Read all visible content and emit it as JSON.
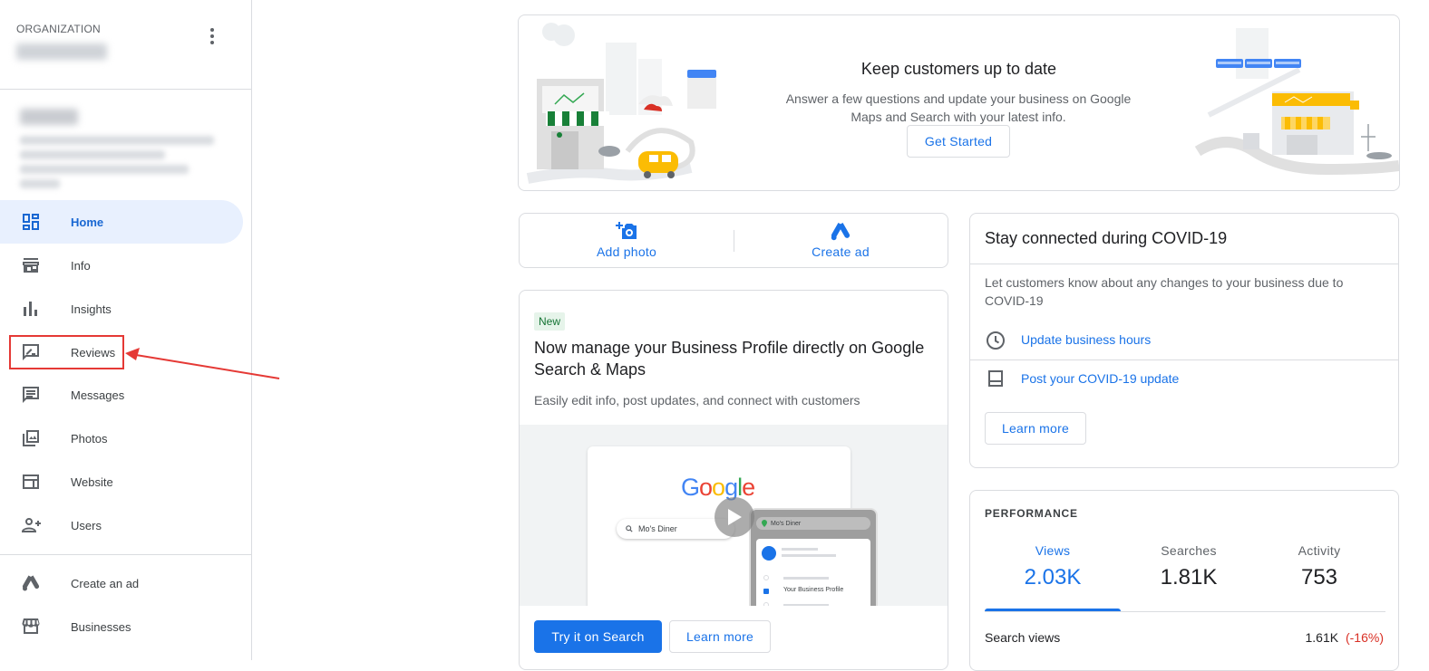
{
  "sidebar": {
    "org_label": "ORGANIZATION",
    "nav": [
      {
        "label": "Home",
        "icon": "dashboard-icon"
      },
      {
        "label": "Info",
        "icon": "storefront-icon"
      },
      {
        "label": "Insights",
        "icon": "bar-chart-icon"
      },
      {
        "label": "Reviews",
        "icon": "rate-review-icon"
      },
      {
        "label": "Messages",
        "icon": "chat-icon"
      },
      {
        "label": "Photos",
        "icon": "photo-library-icon"
      },
      {
        "label": "Website",
        "icon": "web-icon"
      },
      {
        "label": "Users",
        "icon": "person-add-icon"
      }
    ],
    "nav_bottom": [
      {
        "label": "Create an ad",
        "icon": "google-ads-icon"
      },
      {
        "label": "Businesses",
        "icon": "store-icon"
      }
    ]
  },
  "hero": {
    "title": "Keep customers up to date",
    "subtitle": "Answer a few questions and update your business on Google Maps and Search with your latest info.",
    "button": "Get Started"
  },
  "quick_actions": {
    "add_photo": "Add photo",
    "create_ad": "Create ad"
  },
  "new_profile": {
    "badge": "New",
    "title": "Now manage your Business Profile directly on Google Search & Maps",
    "subtitle": "Easily edit info, post updates, and connect with customers",
    "preview": {
      "logo": "Google",
      "search_text": "Mo's Diner",
      "map_pill": "Mo's Diner",
      "list_item": "Your Business Profile"
    },
    "primary_button": "Try it on Search",
    "secondary_button": "Learn more"
  },
  "covid": {
    "title": "Stay connected during COVID-19",
    "text": "Let customers know about any changes to your business due to COVID-19",
    "link_hours": "Update business hours",
    "link_post": "Post your COVID-19 update",
    "button": "Learn more"
  },
  "performance": {
    "label": "PERFORMANCE",
    "tabs": [
      {
        "label": "Views",
        "value": "2.03K"
      },
      {
        "label": "Searches",
        "value": "1.81K"
      },
      {
        "label": "Activity",
        "value": "753"
      }
    ],
    "row_label": "Search views",
    "row_value": "1.61K",
    "row_change": "(-16%)"
  },
  "colors": {
    "accent": "#1a73e8",
    "active_bg": "#e8f0fe",
    "highlight": "#e53935",
    "negative": "#d93025"
  }
}
